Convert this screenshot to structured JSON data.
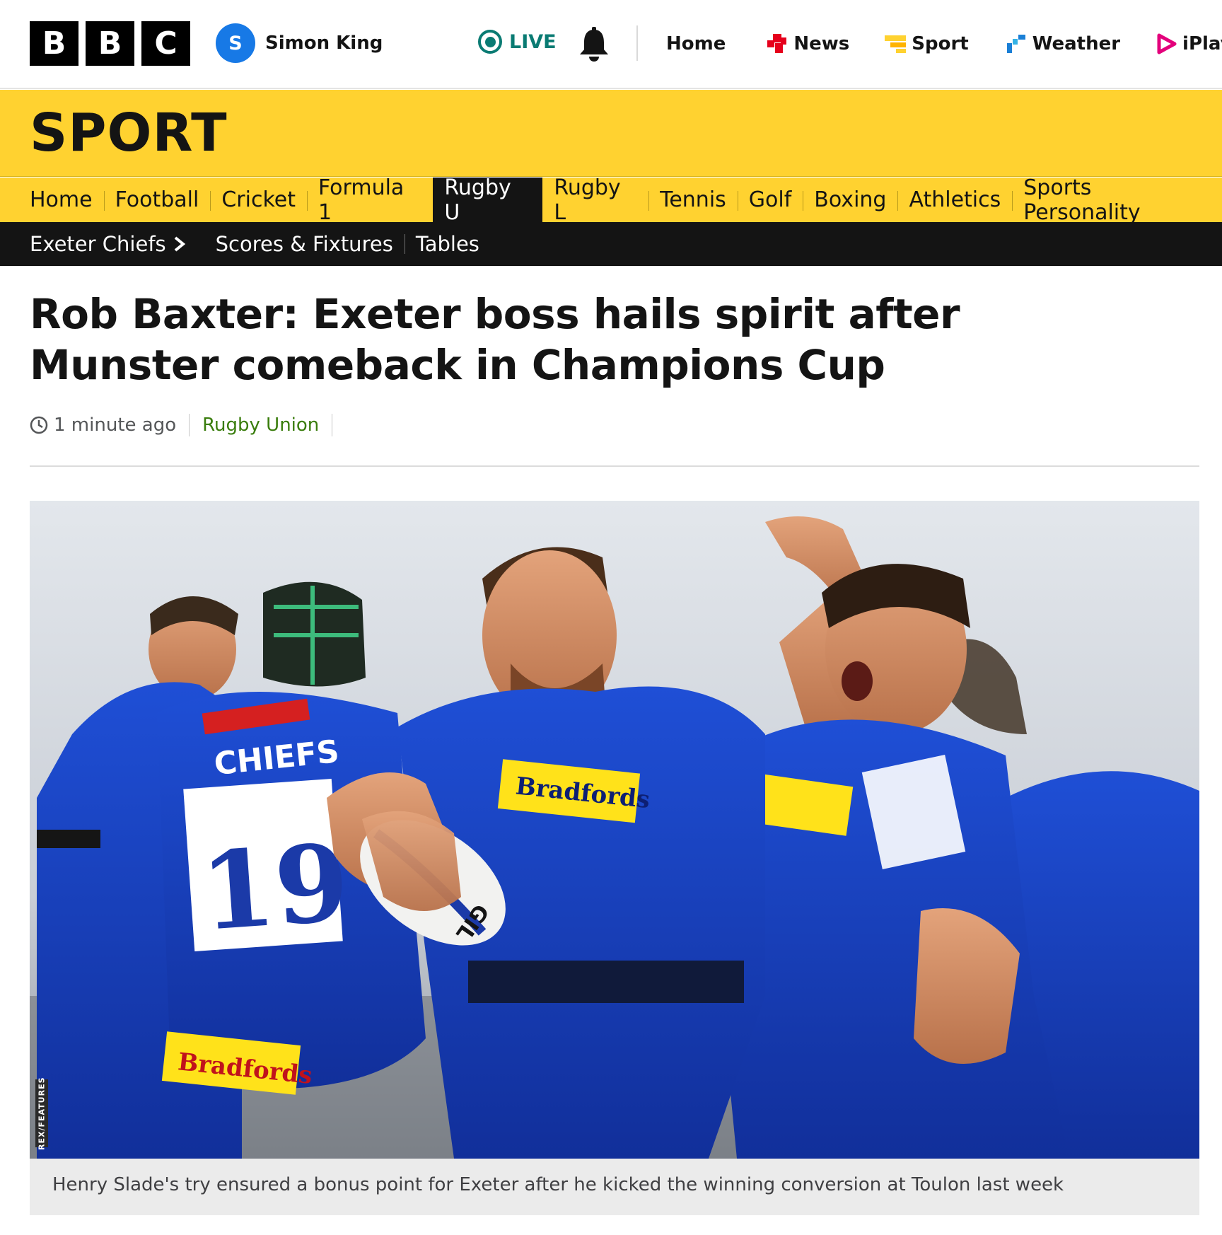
{
  "brand": {
    "logo_letters": [
      "B",
      "B",
      "C"
    ]
  },
  "account": {
    "initial": "S",
    "name": "Simon King",
    "avatar_color": "#1779e6"
  },
  "live": {
    "label": "LIVE",
    "color": "#0a7b73"
  },
  "global_nav": [
    {
      "label": "Home",
      "icon": "none"
    },
    {
      "label": "News",
      "icon": "news-icon",
      "color": "#e6001c"
    },
    {
      "label": "Sport",
      "icon": "sport-icon",
      "color": "#ffd230"
    },
    {
      "label": "Weather",
      "icon": "weather-icon",
      "color": "#1a7fd6"
    },
    {
      "label": "iPlayer",
      "icon": "iplayer-icon",
      "color": "#e3007b"
    }
  ],
  "sport_header": {
    "title": "SPORT",
    "color": "#ffd230"
  },
  "sport_nav": {
    "items": [
      "Home",
      "Football",
      "Cricket",
      "Formula 1",
      "Rugby U",
      "Rugby L",
      "Tennis",
      "Golf",
      "Boxing",
      "Athletics",
      "Sports Personality"
    ],
    "active": "Rugby U"
  },
  "sub_nav": {
    "team": "Exeter Chiefs",
    "links": [
      "Scores & Fixtures",
      "Tables"
    ]
  },
  "article": {
    "headline": "Rob Baxter: Exeter boss hails spirit after Munster comeback in Champions Cup",
    "time": "1 minute ago",
    "topic": "Rugby Union",
    "topic_color": "#3a7d0d",
    "image": {
      "credit": "REX/FEATURES",
      "shirt_sponsor": "Bradfords",
      "shirt_team": "CHIEFS",
      "shirt_number": "19",
      "ball_text": "GIL"
    },
    "caption": "Henry Slade's try ensured a bonus point for Exeter after he kicked the winning conversion at Toulon last week"
  }
}
